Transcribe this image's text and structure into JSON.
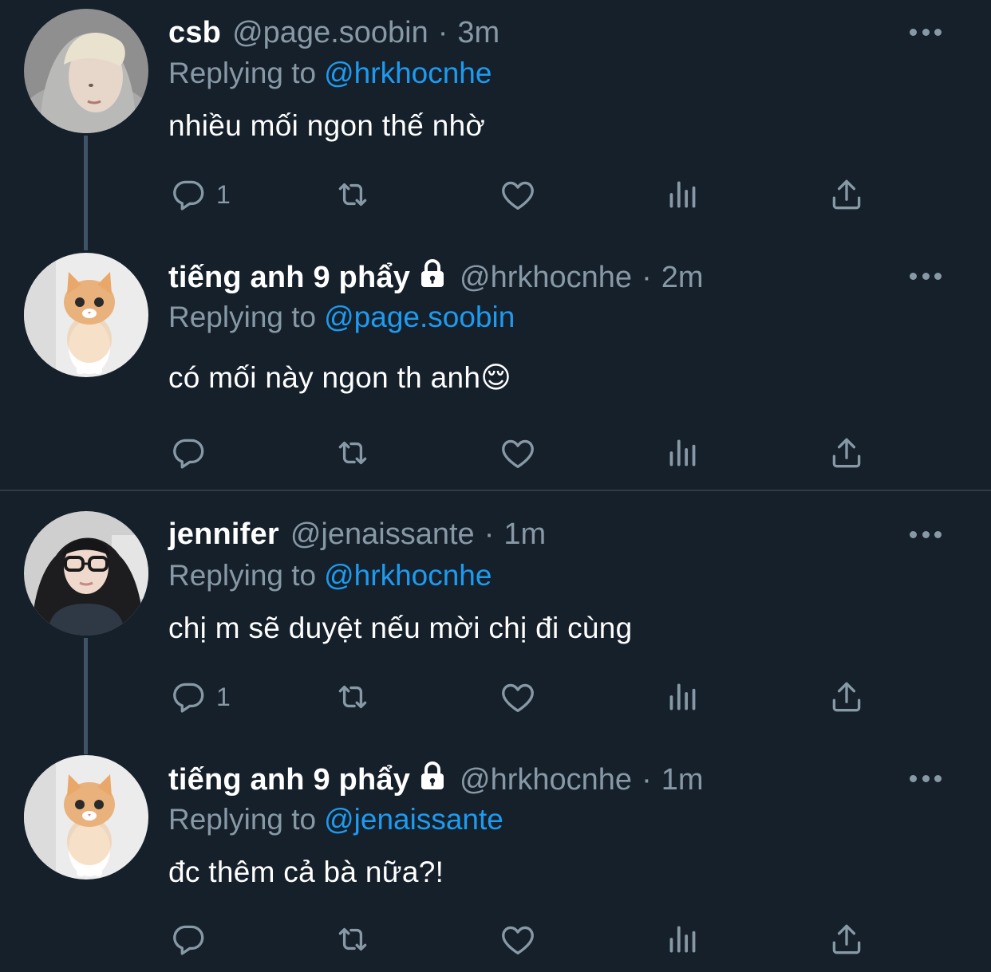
{
  "tweets": [
    {
      "name": "csb",
      "handle": "@page.soobin",
      "separator": "·",
      "time": "3m",
      "replying_label": "Replying to",
      "replying_to": "@hrkhocnhe",
      "text": "nhiều mối ngon thế nhờ",
      "reply_count": "1",
      "avatar": "person-hoodie-photo"
    },
    {
      "name": "tiếng anh 9 phẩy",
      "handle": "@hrkhocnhe",
      "separator": "·",
      "time": "2m",
      "replying_label": "Replying to",
      "replying_to": "@page.soobin",
      "text": "có mối này ngon th anh😌",
      "reply_count": "",
      "avatar": "kitten-photo",
      "protected": true
    },
    {
      "name": "jennifer",
      "handle": "@jenaissante",
      "separator": "·",
      "time": "1m",
      "replying_label": "Replying to",
      "replying_to": "@hrkhocnhe",
      "text": "chị m sẽ duyệt nếu mời chị đi cùng",
      "reply_count": "1",
      "avatar": "girl-glasses-photo"
    },
    {
      "name": "tiếng anh 9 phẩy",
      "handle": "@hrkhocnhe",
      "separator": "·",
      "time": "1m",
      "replying_label": "Replying to",
      "replying_to": "@jenaissante",
      "text": "đc thêm cả bà nữa?!",
      "reply_count": "",
      "avatar": "kitten-photo",
      "protected": true
    }
  ],
  "icons": {
    "reply": "reply-icon",
    "retweet": "retweet-icon",
    "like": "like-icon",
    "analytics": "analytics-icon",
    "share": "share-icon",
    "more": "more-icon",
    "lock": "lock-icon"
  },
  "colors": {
    "background": "#15202b",
    "secondary_text": "#8899a6",
    "link": "#1d9bf0",
    "thread_line": "#3d5466"
  }
}
